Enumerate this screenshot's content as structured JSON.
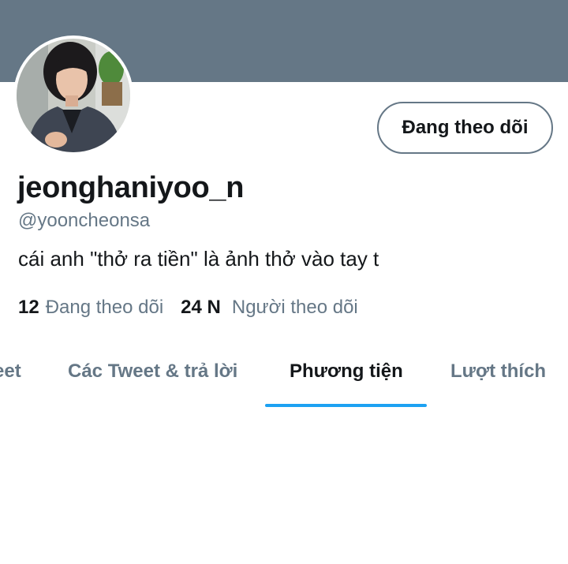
{
  "colors": {
    "banner": "#657786",
    "accent": "#1da1f2",
    "text_primary": "#14171a",
    "text_secondary": "#657786"
  },
  "profile": {
    "display_name": "jeonghaniyoo_n",
    "handle": "@yooncheonsa",
    "bio": "cái anh \"thở ra tiền\" là ảnh thở vào tay t",
    "avatar_icon": "profile-photo"
  },
  "follow_button": {
    "label": "Đang theo dõi"
  },
  "stats": {
    "following_count": "12",
    "following_label": "Đang theo dõi",
    "followers_count": "24 N",
    "followers_label": "Người theo dõi"
  },
  "tabs": [
    {
      "label": "eet",
      "active": false
    },
    {
      "label": "Các Tweet & trả lời",
      "active": false
    },
    {
      "label": "Phương tiện",
      "active": true
    },
    {
      "label": "Lượt thích",
      "active": false
    }
  ]
}
